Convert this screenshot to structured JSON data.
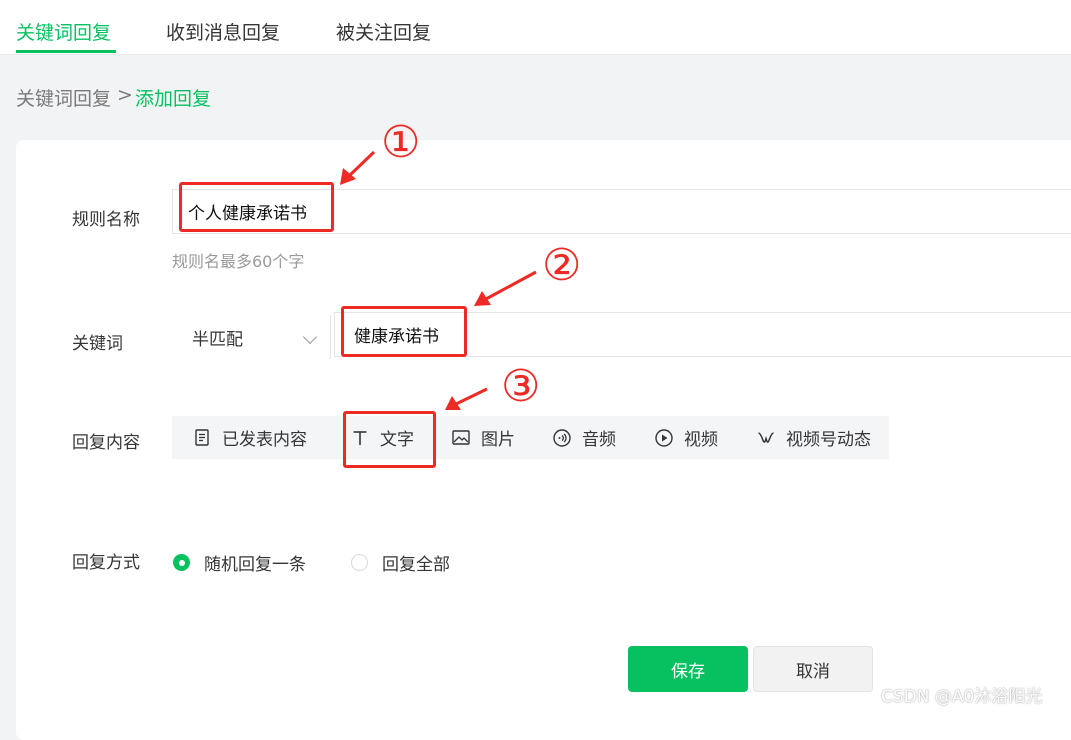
{
  "tabs": [
    {
      "label": "关键词回复",
      "active": true
    },
    {
      "label": "收到消息回复",
      "active": false
    },
    {
      "label": "被关注回复",
      "active": false
    }
  ],
  "breadcrumb": {
    "root": "关键词回复",
    "separator": ">",
    "current": "添加回复"
  },
  "form": {
    "rule_name": {
      "label": "规则名称",
      "value": "个人健康承诺书",
      "hint": "规则名最多60个字"
    },
    "keyword": {
      "label": "关键词",
      "match_type": "半匹配",
      "value": "健康承诺书"
    },
    "reply_content": {
      "label": "回复内容",
      "tools": [
        {
          "label": "已发表内容",
          "icon": "document-icon"
        },
        {
          "label": "文字",
          "icon": "text-icon"
        },
        {
          "label": "图片",
          "icon": "image-icon"
        },
        {
          "label": "音频",
          "icon": "audio-icon"
        },
        {
          "label": "视频",
          "icon": "play-icon"
        },
        {
          "label": "视频号动态",
          "icon": "channels-icon"
        }
      ]
    },
    "reply_mode": {
      "label": "回复方式",
      "options": [
        {
          "label": "随机回复一条",
          "selected": true
        },
        {
          "label": "回复全部",
          "selected": false
        }
      ]
    }
  },
  "actions": {
    "save": "保存",
    "cancel": "取消"
  },
  "annotations": [
    "①",
    "②",
    "③"
  ],
  "watermark": "CSDN @A0沐浴阳光",
  "colors": {
    "accent": "#07c160",
    "annotation": "#ee2a24"
  }
}
